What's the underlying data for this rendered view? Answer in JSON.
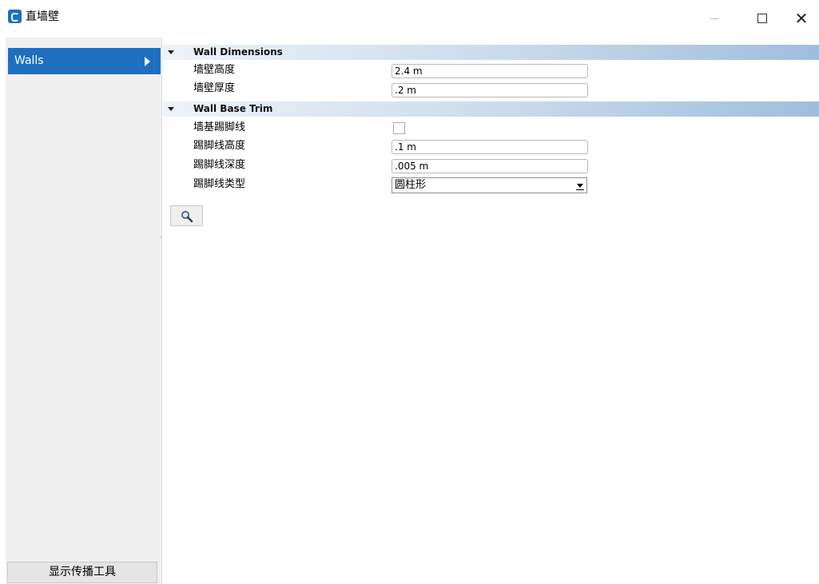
{
  "window": {
    "title": "直墙壁"
  },
  "sidebar": {
    "items": [
      {
        "label": "Walls"
      }
    ],
    "propagate_button": "显示传播工具"
  },
  "sections": [
    {
      "title": "Wall Dimensions",
      "rows": [
        {
          "label": "墙壁高度",
          "value": "2.4 m"
        },
        {
          "label": "墙壁厚度",
          "value": ".2 m"
        }
      ]
    },
    {
      "title": "Wall Base Trim",
      "rows": [
        {
          "label": "墙基踢脚线",
          "checked": false
        },
        {
          "label": "踢脚线高度",
          "value": ".1 m"
        },
        {
          "label": "踢脚线深度",
          "value": ".005 m"
        },
        {
          "label": "踢脚线类型",
          "selected": "圆柱形"
        }
      ]
    }
  ],
  "colors": {
    "accent": "#1f6fc0",
    "section_header_end": "#9fbedc"
  },
  "icons": [
    "app-icon",
    "chevron-right-icon",
    "collapse-arrow-icon",
    "search-icon",
    "minimize-icon",
    "maximize-icon",
    "close-icon"
  ]
}
